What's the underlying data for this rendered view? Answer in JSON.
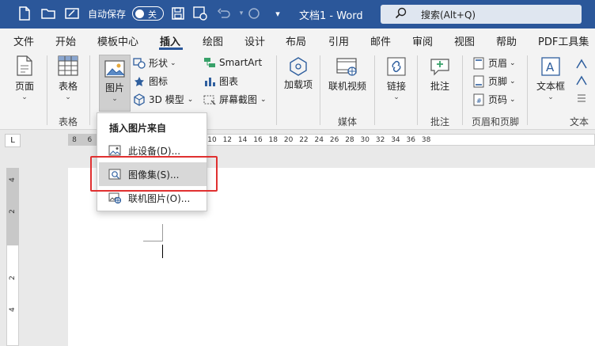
{
  "titlebar": {
    "autosave_label": "自动保存",
    "autosave_state": "关",
    "doc_title": "文档1  -  Word",
    "search_placeholder": "搜索(Alt+Q)",
    "bg_color": "#2b579a"
  },
  "tabs": [
    "文件",
    "开始",
    "模板中心",
    "插入",
    "绘图",
    "设计",
    "布局",
    "引用",
    "邮件",
    "审阅",
    "视图",
    "帮助",
    "PDF工具集"
  ],
  "active_tab": "插入",
  "ribbon": {
    "pages_label": "页面",
    "table_label": "表格",
    "table_group": "表格",
    "picture_label": "图片",
    "shapes_label": "形状",
    "icons_label": "图标",
    "model3d_label": "3D 模型",
    "smartart_label": "SmartArt",
    "chart_label": "图表",
    "screenshot_label": "屏幕截图",
    "addins_label": "加载项",
    "online_video_label": "联机视频",
    "media_group": "媒体",
    "link_label": "链接",
    "comment_label": "批注",
    "comment_group": "批注",
    "header_label": "页眉",
    "footer_label": "页脚",
    "page_number_label": "页码",
    "header_footer_group": "页眉和页脚",
    "textbox_label": "文本框",
    "text_group": "文本"
  },
  "ruler": {
    "numbers": [
      "8",
      "6",
      "4",
      "2",
      "",
      "2",
      "4",
      "6",
      "8",
      "10",
      "12",
      "14",
      "16",
      "18",
      "20",
      "22",
      "24",
      "26",
      "28",
      "30",
      "32",
      "34",
      "36",
      "38"
    ],
    "corner_symbol": "L"
  },
  "vruler": [
    "4",
    "2",
    "2",
    "4"
  ],
  "dropdown": {
    "header": "插入图片来自",
    "items": [
      {
        "label": "此设备(D)...",
        "icon": "device-image-icon"
      },
      {
        "label": "图像集(S)...",
        "icon": "image-collection-icon"
      },
      {
        "label": "联机图片(O)...",
        "icon": "online-image-icon"
      }
    ],
    "selected_index": 1
  },
  "colors": {
    "accent": "#2b579a",
    "highlight_border": "#e03030"
  }
}
